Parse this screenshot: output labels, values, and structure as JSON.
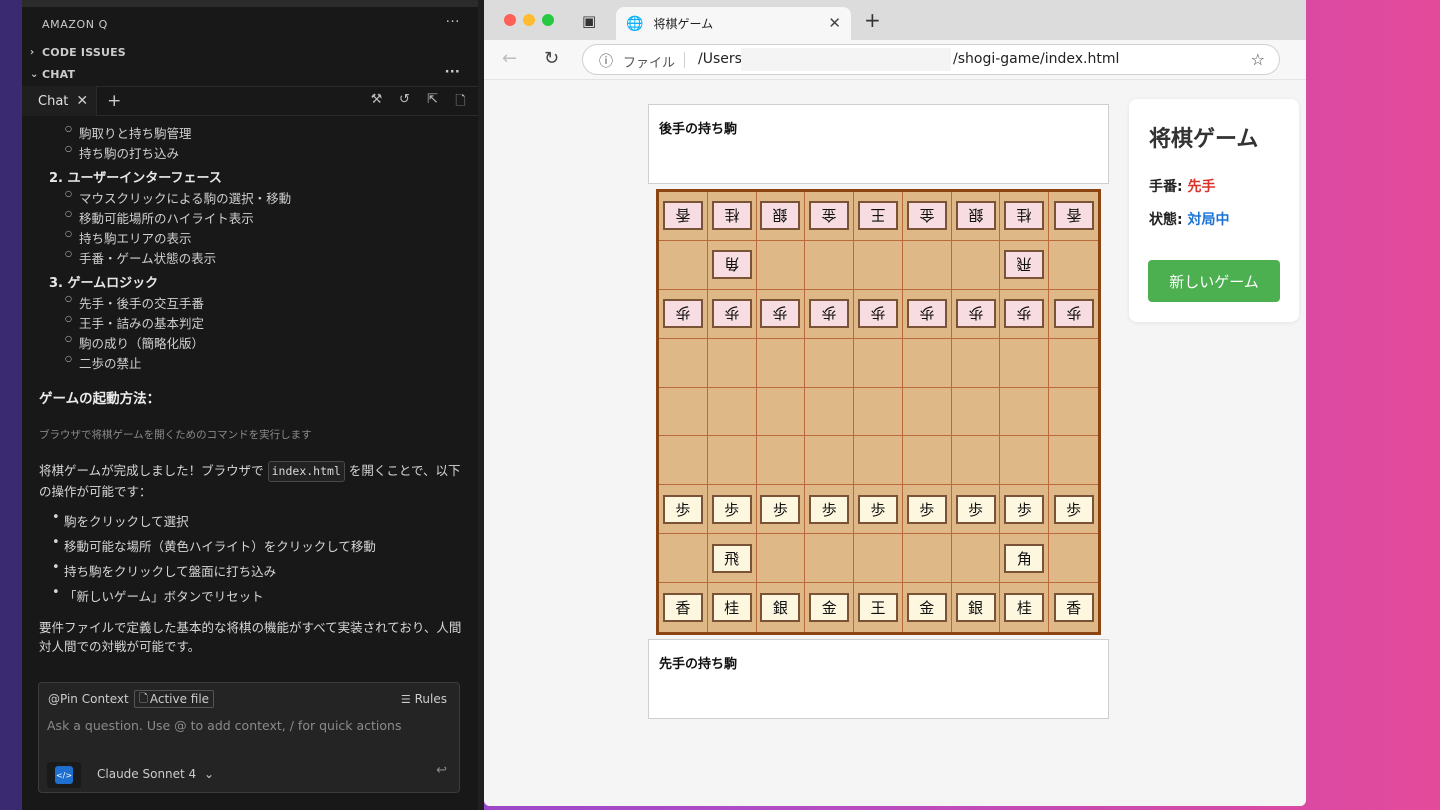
{
  "ide": {
    "panel_title": "AMAZON Q",
    "section_code_issues": "CODE ISSUES",
    "section_chat": "CHAT",
    "more_dots": "···",
    "chat_tab_label": "Chat",
    "plus": "+",
    "tab_action_icons": [
      "tools-icon",
      "history-icon",
      "open-external-icon",
      "file-icon"
    ],
    "messages": {
      "sub_items_top": [
        "駒取りと持ち駒管理",
        "持ち駒の打ち込み"
      ],
      "section2_title": "2. ユーザーインターフェース",
      "section2_items": [
        "マウスクリックによる駒の選択・移動",
        "移動可能場所のハイライト表示",
        "持ち駒エリアの表示",
        "手番・ゲーム状態の表示"
      ],
      "section3_title": "3. ゲームロジック",
      "section3_items": [
        "先手・後手の交互手番",
        "王手・詰みの基本判定",
        "駒の成り（簡略化版）",
        "二歩の禁止"
      ],
      "launch_heading": "ゲームの起動方法：",
      "tool_note": "ブラウザで将棋ゲームを開くためのコマンドを実行します",
      "complete_pre": "将棋ゲームが完成しました！ブラウザで",
      "complete_code": "index.html",
      "complete_post": "を開くことで、以下の操作が可能です：",
      "bullets": [
        "駒をクリックして選択",
        "移動可能な場所（黄色ハイライト）をクリックして移動",
        "持ち駒をクリックして盤面に打ち込み",
        "「新しいゲーム」ボタンでリセット"
      ],
      "closing": "要件ファイルで定義した基本的な将棋の機能がすべて実装されており、人間対人間での対戦が可能です。"
    },
    "input": {
      "pin_context": "@Pin Context",
      "active_file": "Active file",
      "rules": "Rules",
      "placeholder": "Ask a question. Use @ to add context, / for quick actions",
      "model": "Claude Sonnet 4"
    }
  },
  "browser": {
    "tab_title": "将棋ゲーム",
    "url_scheme": "ファイル",
    "url_prefix": "/Users",
    "url_suffix": "/shogi-game/index.html",
    "page": {
      "gote_hand_label": "後手の持ち駒",
      "sente_hand_label": "先手の持ち駒",
      "game_title": "将棋ゲーム",
      "turn_label": "手番: ",
      "turn_value": "先手",
      "status_label": "状態: ",
      "status_value": "対局中",
      "new_game_button": "新しいゲーム",
      "board": [
        [
          "g:香",
          "g:桂",
          "g:銀",
          "g:金",
          "g:王",
          "g:金",
          "g:銀",
          "g:桂",
          "g:香"
        ],
        [
          "",
          "g:角",
          "",
          "",
          "",
          "",
          "",
          "g:飛",
          ""
        ],
        [
          "g:歩",
          "g:歩",
          "g:歩",
          "g:歩",
          "g:歩",
          "g:歩",
          "g:歩",
          "g:歩",
          "g:歩"
        ],
        [
          "",
          "",
          "",
          "",
          "",
          "",
          "",
          "",
          ""
        ],
        [
          "",
          "",
          "",
          "",
          "",
          "",
          "",
          "",
          ""
        ],
        [
          "",
          "",
          "",
          "",
          "",
          "",
          "",
          "",
          ""
        ],
        [
          "s:歩",
          "s:歩",
          "s:歩",
          "s:歩",
          "s:歩",
          "s:歩",
          "s:歩",
          "s:歩",
          "s:歩"
        ],
        [
          "",
          "s:飛",
          "",
          "",
          "",
          "",
          "",
          "s:角",
          ""
        ],
        [
          "s:香",
          "s:桂",
          "s:銀",
          "s:金",
          "s:王",
          "s:金",
          "s:銀",
          "s:桂",
          "s:香"
        ]
      ]
    }
  }
}
